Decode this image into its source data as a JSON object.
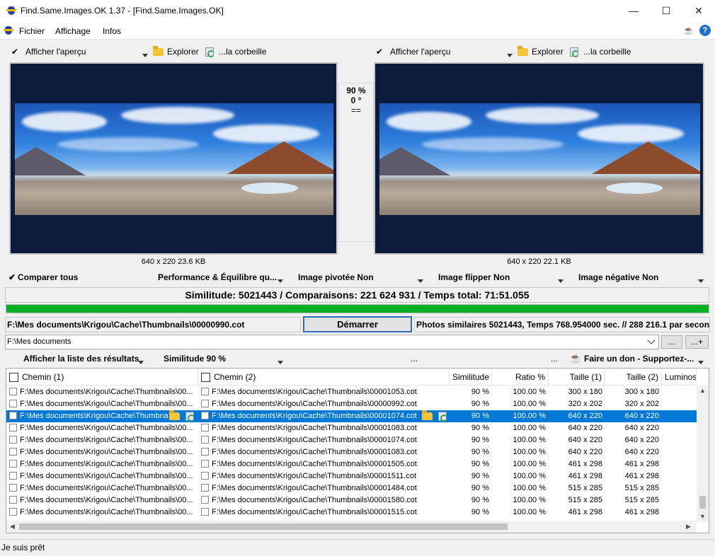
{
  "window": {
    "title": "Find.Same.Images.OK 1.37 - [Find.Same.Images.OK]",
    "minimize": "—",
    "maximize": "☐",
    "close": "✕"
  },
  "menu": {
    "items": [
      "Fichier",
      "Affichage",
      "Infos"
    ],
    "help": "?"
  },
  "left_toolbar": {
    "check": "✔",
    "preview": "Afficher l'aperçu",
    "explorer": "Explorer",
    "bin": "...la corbeille"
  },
  "right_toolbar": {
    "check": "✔",
    "preview": "Afficher l'aperçu",
    "explorer": "Explorer",
    "bin": "...la corbeille"
  },
  "left_image": {
    "caption": "640 x 220 23.6 KB"
  },
  "right_image": {
    "caption": "640 x 220 22.1 KB"
  },
  "middle": {
    "similarity": "90 %",
    "rotation": "0 °",
    "equal": "=="
  },
  "options": {
    "compare_all": "Comparer tous",
    "performance": "Performance & Équilibre qu...",
    "rotated": "Image pivotée Non",
    "flipped": "Image flipper Non",
    "negative": "Image négative Non"
  },
  "stats": {
    "text": "Similitude: 5021443 / Comparaisons: 221 624 931 / Temps total: 71:51.055",
    "progress": 1.0
  },
  "current_path": "F:\\Mes documents\\Krigou\\Cache\\Thumbnails\\00000990.cot",
  "start_button": "Démarrer",
  "info_text": "Photos similaires 5021443, Temps 768.954000 sec. // 288 216.1 par seconde",
  "folder": {
    "value": "F:\\Mes documents",
    "browse_button": "...",
    "add_button": "...+"
  },
  "results_toolbar": {
    "show_list": "Afficher la liste des résultats",
    "similarity": "Similitude 90 %",
    "dots1": "...",
    "dots2": "...",
    "donate": "Faire un don - Supportez-..."
  },
  "table": {
    "headers": [
      "Chemin (1)",
      "Chemin (2)",
      "Similitude",
      "Ratio %",
      "Taille (1)",
      "Taille (2)",
      "Luminosit"
    ],
    "rows": [
      [
        "F:\\Mes documents\\Krigou\\Cache\\Thumbnails\\00...",
        "F:\\Mes documents\\Krigou\\Cache\\Thumbnails\\00001053.cot",
        "90 %",
        "100.00 %",
        "300 x 180",
        "300 x 180"
      ],
      [
        "F:\\Mes documents\\Krigou\\Cache\\Thumbnails\\00...",
        "F:\\Mes documents\\Krigou\\Cache\\Thumbnails\\00000992.cot",
        "90 %",
        "100.00 %",
        "320 x 202",
        "320 x 202"
      ],
      [
        "F:\\Mes documents\\Krigou\\Cache\\Thumbna",
        "F:\\Mes documents\\Krigou\\Cache\\Thumbnails\\00001074.cot",
        "90 %",
        "100.00 %",
        "640 x 220",
        "640 x 220"
      ],
      [
        "F:\\Mes documents\\Krigou\\Cache\\Thumbnails\\00...",
        "F:\\Mes documents\\Krigou\\Cache\\Thumbnails\\00001083.cot",
        "90 %",
        "100.00 %",
        "640 x 220",
        "640 x 220"
      ],
      [
        "F:\\Mes documents\\Krigou\\Cache\\Thumbnails\\00...",
        "F:\\Mes documents\\Krigou\\Cache\\Thumbnails\\00001074.cot",
        "90 %",
        "100.00 %",
        "640 x 220",
        "640 x 220"
      ],
      [
        "F:\\Mes documents\\Krigou\\Cache\\Thumbnails\\00...",
        "F:\\Mes documents\\Krigou\\Cache\\Thumbnails\\00001083.cot",
        "90 %",
        "100.00 %",
        "640 x 220",
        "640 x 220"
      ],
      [
        "F:\\Mes documents\\Krigou\\Cache\\Thumbnails\\00...",
        "F:\\Mes documents\\Krigou\\Cache\\Thumbnails\\00001505.cot",
        "90 %",
        "100.00 %",
        "461 x 298",
        "461 x 298"
      ],
      [
        "F:\\Mes documents\\Krigou\\Cache\\Thumbnails\\00...",
        "F:\\Mes documents\\Krigou\\Cache\\Thumbnails\\00001511.cot",
        "90 %",
        "100.00 %",
        "461 x 298",
        "461 x 298"
      ],
      [
        "F:\\Mes documents\\Krigou\\Cache\\Thumbnails\\00...",
        "F:\\Mes documents\\Krigou\\Cache\\Thumbnails\\00001484.cot",
        "90 %",
        "100.00 %",
        "515 x 285",
        "515 x 285"
      ],
      [
        "F:\\Mes documents\\Krigou\\Cache\\Thumbnails\\00...",
        "F:\\Mes documents\\Krigou\\Cache\\Thumbnails\\00001580.cot",
        "90 %",
        "100.00 %",
        "515 x 285",
        "515 x 285"
      ],
      [
        "F:\\Mes documents\\Krigou\\Cache\\Thumbnails\\00...",
        "F:\\Mes documents\\Krigou\\Cache\\Thumbnails\\00001515.cot",
        "90 %",
        "100.00 %",
        "461 x 298",
        "461 x 298"
      ]
    ],
    "selected_row": 2
  },
  "statusbar": {
    "text": "Je suis prêt"
  },
  "colors": {
    "selection": "#0078d7",
    "progress": "#06b025",
    "image_bg": "#0d1b3c"
  },
  "icons": [
    "app-icon",
    "folder-icon",
    "recycle-bin-icon",
    "coffee-cup-icon",
    "help-icon",
    "checkmark-icon",
    "dropdown-arrow-icon"
  ]
}
